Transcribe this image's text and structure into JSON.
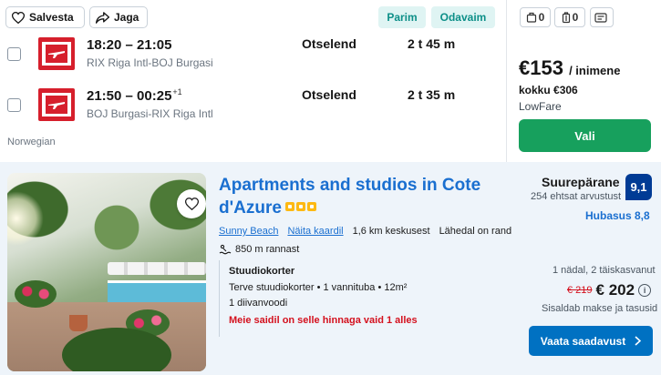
{
  "flight": {
    "save_label": "Salvesta",
    "share_label": "Jaga",
    "tags": [
      "Parim",
      "Odavaim"
    ],
    "legs": [
      {
        "times": "18:20 – 21:05",
        "day_offset": "",
        "route": "RIX Riga Intl-BOJ Burgasi",
        "stops": "Otselend",
        "duration": "2 t 45 m"
      },
      {
        "times": "21:50 – 00:25",
        "day_offset": "+1",
        "route": "BOJ Burgasi-RIX Riga Intl",
        "stops": "Otselend",
        "duration": "2 t 35 m"
      }
    ],
    "operator": "Norwegian",
    "bags": {
      "carry_on": "0",
      "checked": "0"
    },
    "price": {
      "amount": "€153",
      "unit": "/ inimene",
      "total": "kokku €306",
      "provider": "LowFare"
    },
    "select_label": "Vali",
    "colors": {
      "accent": "#17a05d",
      "tag_text": "#0d8f88",
      "tag_bg": "#dff4f3",
      "logo": "#d61f2c"
    }
  },
  "hotel": {
    "title": "Apartments and studios in Cote d'Azure",
    "stars": 3,
    "location": {
      "area": "Sunny Beach",
      "map_link": "Näita kaardil",
      "distance": "1,6 km keskusest",
      "beach_note": "Lähedal on rand"
    },
    "beach_distance": "850 m rannast",
    "room": {
      "type": "Stuudiokorter",
      "details": "Terve stuudiokorter • 1 vannituba • 12m²",
      "beds": "1 diivanvoodi",
      "scarcity": "Meie saidil on selle hinnaga vaid 1 alles"
    },
    "rating": {
      "label": "Suurepärane",
      "reviews": "254 ehtsat arvustust",
      "score": "9,1",
      "location_score": "Hubasus 8,8"
    },
    "stay": "1 nädal, 2 täiskasvanut",
    "price": {
      "old": "€ 219",
      "new": "€ 202",
      "info": "i"
    },
    "tax_note": "Sisaldab makse ja tasusid",
    "cta_label": "Vaata saadavust",
    "colors": {
      "link": "#1a6fd0",
      "score_bg": "#003b95",
      "cta": "#0071c2",
      "alert": "#d4111e",
      "stars": "#fdb913"
    }
  }
}
